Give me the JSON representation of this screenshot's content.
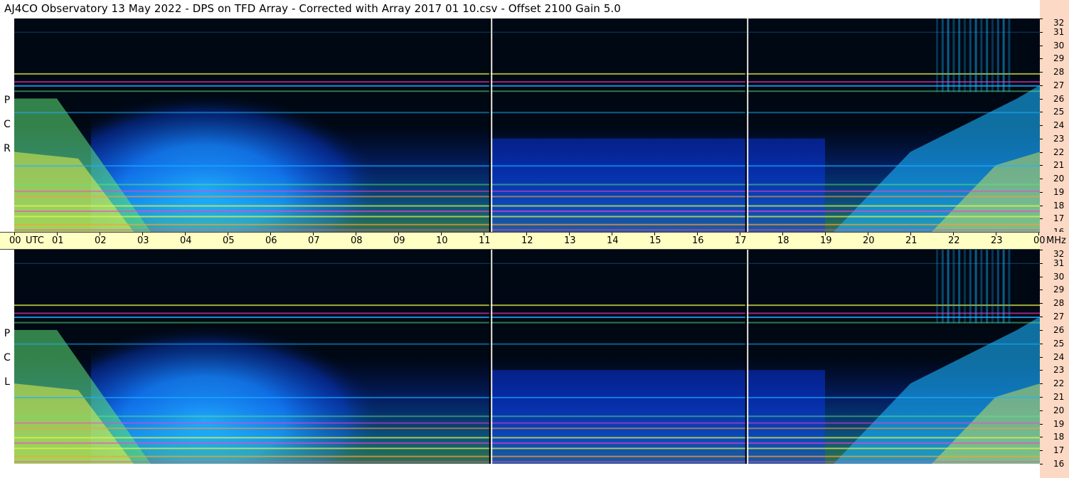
{
  "title": "AJ4CO Observatory  13 May 2022  -  DPS on TFD Array  -  Corrected with Array 2017 01 10.csv  -  Offset 2100  Gain 5.0",
  "top_panel_label": [
    "R",
    "C",
    "P"
  ],
  "bottom_panel_label": [
    "L",
    "C",
    "P"
  ],
  "colors": {
    "background_low": "#000814",
    "blue": "#0a3cff",
    "cyan": "#19b4ff",
    "green": "#5fe878",
    "yellow": "#e8f24a",
    "orange": "#ff9b3a",
    "magenta": "#ff3ad0",
    "time_bar": "#ffffc4",
    "freq_axis": "#fbd9c4"
  },
  "chart_data": [
    {
      "type": "heatmap",
      "panel": "RCP",
      "x_axis": {
        "unit": "UTC",
        "range": [
          0,
          24
        ],
        "tick_labels": [
          "00",
          "01",
          "02",
          "03",
          "04",
          "05",
          "06",
          "07",
          "08",
          "09",
          "10",
          "11",
          "12",
          "13",
          "14",
          "15",
          "16",
          "17",
          "18",
          "19",
          "20",
          "21",
          "22",
          "23",
          "00"
        ]
      },
      "y_axis": {
        "unit": "MHz",
        "range": [
          16,
          32
        ],
        "tick_labels": [
          "32",
          "31",
          "30",
          "29",
          "28",
          "27",
          "26",
          "25",
          "24",
          "23",
          "22",
          "21",
          "20",
          "19",
          "18",
          "17",
          "16"
        ]
      }
    },
    {
      "type": "heatmap",
      "panel": "LCP",
      "x_axis": {
        "unit": "UTC",
        "range": [
          0,
          24
        ]
      },
      "y_axis": {
        "unit": "MHz",
        "range": [
          16,
          32
        ],
        "tick_labels": [
          "32",
          "31",
          "30",
          "29",
          "28",
          "27",
          "26",
          "25",
          "24",
          "23",
          "22",
          "21",
          "20",
          "19",
          "18",
          "17",
          "16"
        ]
      }
    }
  ],
  "time_axis": {
    "labels": [
      "00",
      "UTC",
      "01",
      "02",
      "03",
      "04",
      "05",
      "06",
      "07",
      "08",
      "09",
      "10",
      "11",
      "12",
      "13",
      "14",
      "15",
      "16",
      "17",
      "18",
      "19",
      "20",
      "21",
      "22",
      "23",
      "00",
      "MHz"
    ]
  }
}
